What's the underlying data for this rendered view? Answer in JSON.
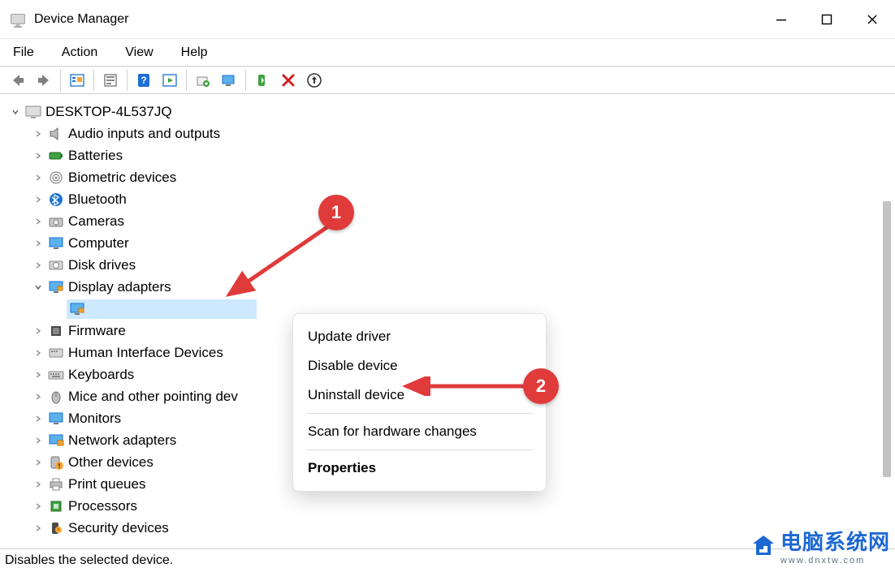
{
  "window": {
    "title": "Device Manager"
  },
  "menu": {
    "file": "File",
    "action": "Action",
    "view": "View",
    "help": "Help"
  },
  "tree": {
    "root": "DESKTOP-4L537JQ",
    "items": {
      "audio": "Audio inputs and outputs",
      "batteries": "Batteries",
      "biometric": "Biometric devices",
      "bluetooth": "Bluetooth",
      "cameras": "Cameras",
      "computer": "Computer",
      "disk": "Disk drives",
      "display": "Display adapters",
      "display_child": "",
      "firmware": "Firmware",
      "hid": "Human Interface Devices",
      "keyboards": "Keyboards",
      "mice": "Mice and other pointing dev",
      "monitors": "Monitors",
      "network": "Network adapters",
      "other": "Other devices",
      "print": "Print queues",
      "processors": "Processors",
      "security": "Security devices"
    }
  },
  "context_menu": {
    "update": "Update driver",
    "disable": "Disable device",
    "uninstall": "Uninstall device",
    "scan": "Scan for hardware changes",
    "properties": "Properties"
  },
  "status": "Disables the selected device.",
  "annotations": {
    "one": "1",
    "two": "2"
  },
  "watermark": {
    "text": "电脑系统网",
    "url": "www.dnxtw.com"
  }
}
